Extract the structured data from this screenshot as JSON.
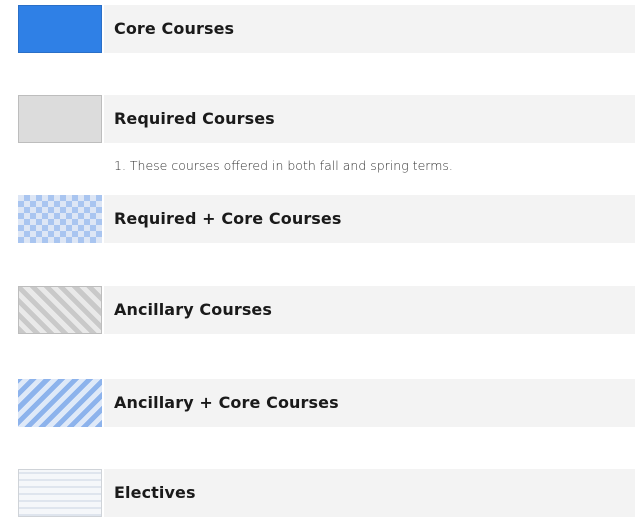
{
  "legend": {
    "items": [
      {
        "label": "Core Courses",
        "swatch": "solid-blue",
        "color": "#2f80e6"
      },
      {
        "label": "Required Courses",
        "swatch": "solid-gray",
        "color": "#dcdcdc"
      },
      {
        "label": "Required + Core Courses",
        "swatch": "blue-checkerboard",
        "color": "#a9c5f0"
      },
      {
        "label": "Ancillary Courses",
        "swatch": "gray-diagonal-stripes",
        "color": "#c9c9c9"
      },
      {
        "label": "Ancillary + Core Courses",
        "swatch": "blue-diagonal-stripes",
        "color": "#8db3ec"
      },
      {
        "label": "Electives",
        "swatch": "light-horizontal-stripes",
        "color": "#dfe5ee"
      }
    ],
    "note": "1. These courses offered in both fall and spring terms."
  }
}
